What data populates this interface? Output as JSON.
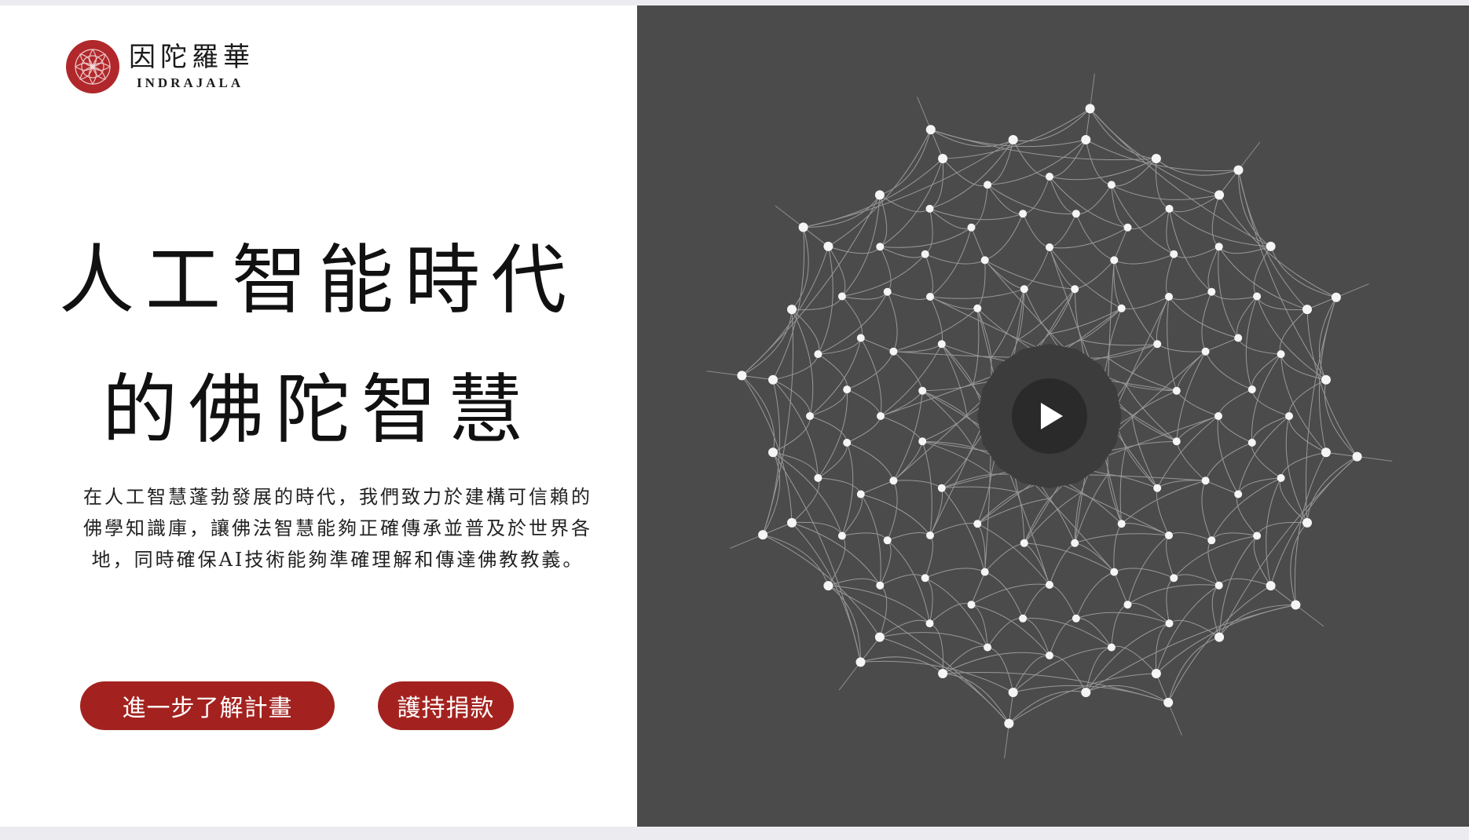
{
  "brand": {
    "name_zh": "因陀羅華",
    "name_en": "INDRAJALA",
    "color": "#b0282b"
  },
  "hero": {
    "headline_line1": "人工智能時代",
    "headline_line2": "的佛陀智慧",
    "description_line1": "在人工智慧蓬勃發展的時代，我們致力於建構可信賴的",
    "description_line2": "佛學知識庫，讓佛法智慧能夠正確傳承並普及於世界各",
    "description_line3": "地，同時確保AI技術能夠準確理解和傳達佛教教義。"
  },
  "actions": {
    "learn_more_label": "進一步了解計畫",
    "donate_label": "護持捐款",
    "button_color": "#a3221f"
  },
  "video": {
    "background": "#4b4b4b",
    "play_icon": "play-icon",
    "graphic": "mandala-network"
  }
}
